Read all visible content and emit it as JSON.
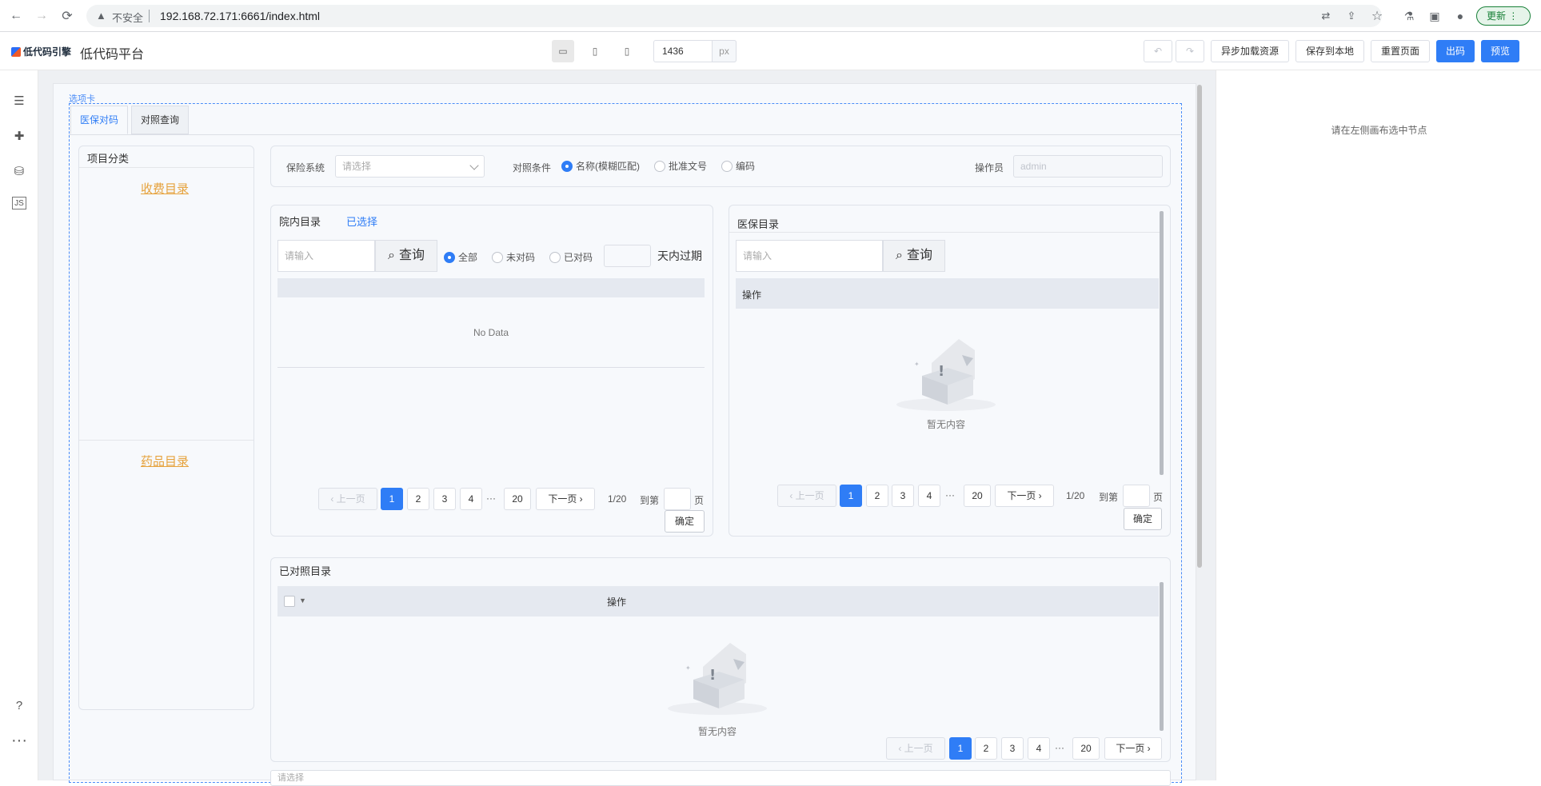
{
  "browser": {
    "insecure": "不安全",
    "url": "192.168.72.171:6661/index.html",
    "update": "更新"
  },
  "header": {
    "logo": "低代码引擎",
    "title": "低代码平台",
    "width_value": "1436",
    "width_unit": "px",
    "buttons": {
      "async_load": "异步加载资源",
      "save_local": "保存到本地",
      "reset_page": "重置页面",
      "export": "出码",
      "preview": "预览"
    }
  },
  "right_panel": {
    "hint": "请在左侧画布选中节点"
  },
  "tabs": {
    "label": "选项卡",
    "items": [
      "医保对码",
      "对照查询"
    ]
  },
  "category": {
    "title": "项目分类",
    "link1": "收费目录",
    "link2": "药品目录"
  },
  "filter": {
    "insurance_label": "保险系统",
    "insurance_placeholder": "请选择",
    "condition_label": "对照条件",
    "radios": [
      "名称(模糊匹配)",
      "批准文号",
      "编码"
    ],
    "operator_label": "操作员",
    "operator_value": "admin"
  },
  "hospital": {
    "title": "院内目录",
    "selected": "已选择",
    "placeholder": "请输入",
    "query": "查询",
    "radios": [
      "全部",
      "未对码",
      "已对码"
    ],
    "expire_suffix": "天内过期",
    "empty": "No Data"
  },
  "insurance_catalog": {
    "title": "医保目录",
    "placeholder": "请输入",
    "query": "查询",
    "col_op": "操作",
    "empty": "暂无内容"
  },
  "pagination": {
    "prev": "上一页",
    "next": "下一页",
    "pages": [
      "1",
      "2",
      "3",
      "4",
      "···",
      "20"
    ],
    "total": "1/20",
    "goto": "到第",
    "page_unit": "页",
    "confirm": "确定"
  },
  "matched": {
    "title": "已对照目录",
    "col_op": "操作",
    "empty": "暂无内容",
    "bottom_placeholder": "请选择"
  },
  "colors": {
    "primary": "#2f7df6",
    "link_orange": "#e6a23c"
  }
}
